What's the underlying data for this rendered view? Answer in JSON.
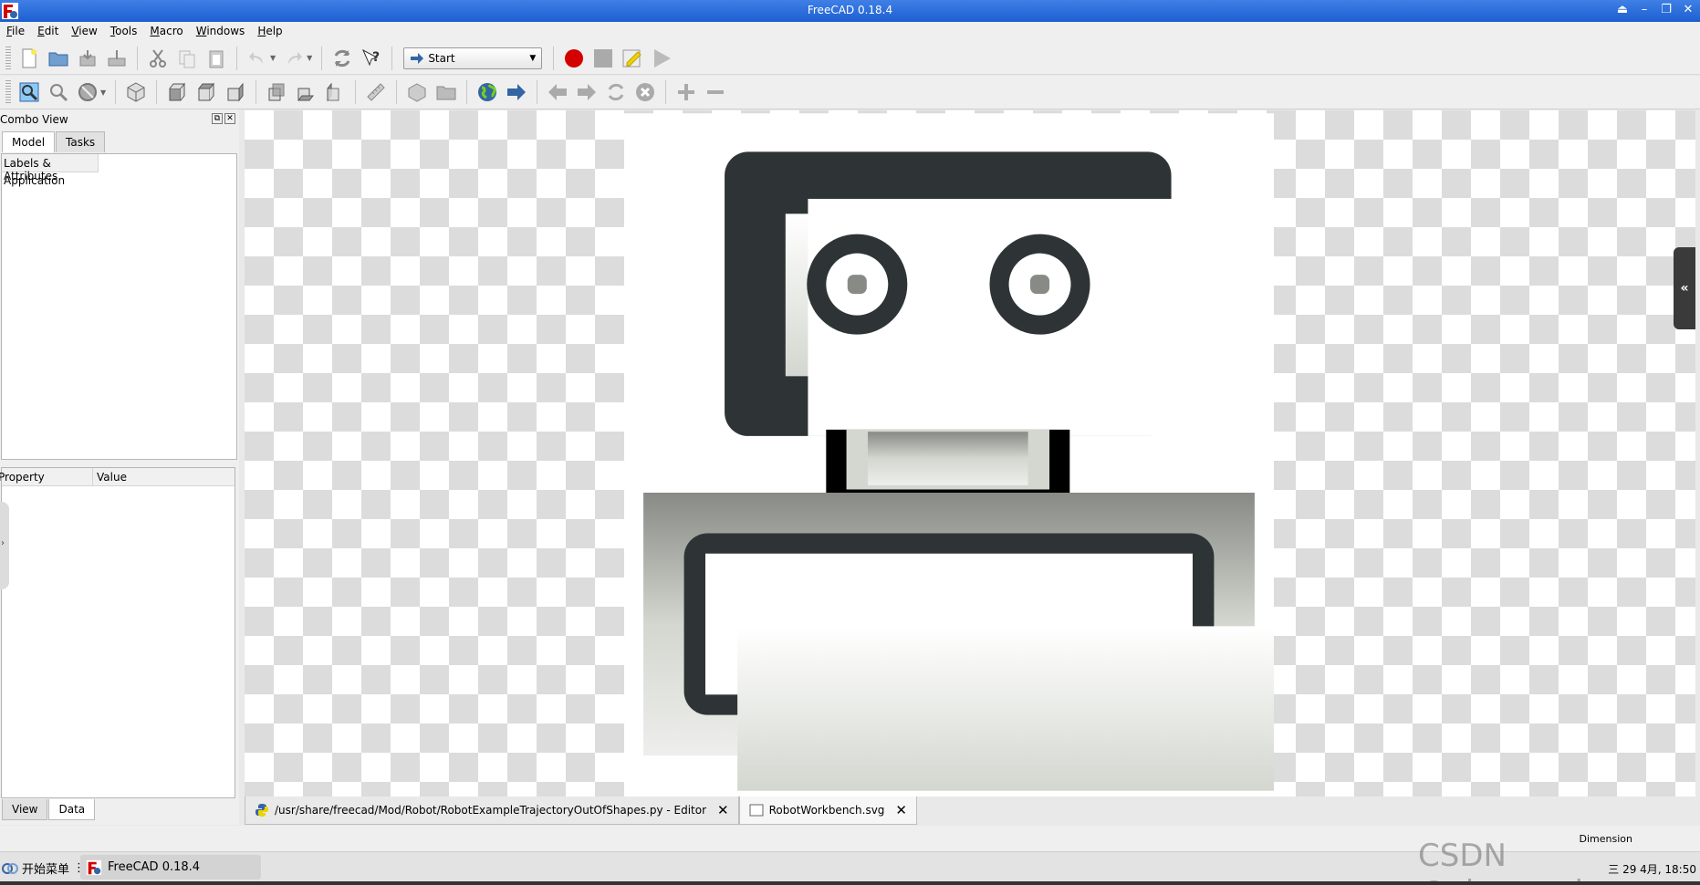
{
  "window": {
    "title": "FreeCAD 0.18.4"
  },
  "menu": [
    "File",
    "Edit",
    "View",
    "Tools",
    "Macro",
    "Windows",
    "Help"
  ],
  "toolbar": {
    "workbench_selected": "Start",
    "icons_row1": [
      "new-file-icon",
      "open-file-icon",
      "save-icon",
      "save-as-icon",
      "cut-icon",
      "copy-icon",
      "paste-icon",
      "undo-icon",
      "redo-icon",
      "refresh-icon",
      "whats-this-icon"
    ],
    "macro_icons": [
      "record-macro-icon",
      "stop-macro-icon",
      "edit-macro-icon",
      "run-macro-icon"
    ]
  },
  "combo_view": {
    "title": "Combo View",
    "tabs": [
      "Model",
      "Tasks"
    ],
    "active_tab": "Model",
    "tree_header": "Labels & Attributes",
    "tree_items": [
      "Application"
    ],
    "property_headers": [
      "Property",
      "Value"
    ],
    "bottom_tabs": [
      "View",
      "Data"
    ],
    "active_bottom_tab": "Data"
  },
  "document_tabs": [
    {
      "label": "/usr/share/freecad/Mod/Robot/RobotExampleTrajectoryOutOfShapes.py - Editor",
      "icon": "python-icon"
    },
    {
      "label": "RobotWorkbench.svg",
      "icon": "svg-document-icon"
    }
  ],
  "statusbar": {
    "right_text": "Dimension"
  },
  "taskbar": {
    "start_label": "开始菜单",
    "task_label": "FreeCAD 0.18.4",
    "clock": "三 29 4月, 18:50"
  },
  "watermark": "CSDN @zhangrelay",
  "colors": {
    "titlebar": "#2b6fdd",
    "robot_dark": "#2e3436",
    "record_red": "#d40000"
  }
}
